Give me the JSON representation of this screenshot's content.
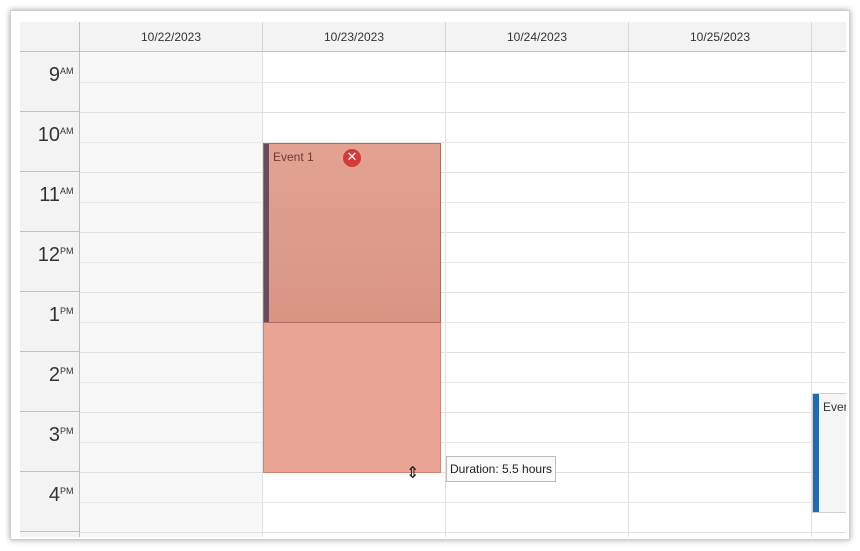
{
  "days": [
    "10/22/2023",
    "10/23/2023",
    "10/24/2023",
    "10/25/2023",
    ""
  ],
  "hours": [
    {
      "num": "9",
      "ampm": "AM"
    },
    {
      "num": "10",
      "ampm": "AM"
    },
    {
      "num": "11",
      "ampm": "AM"
    },
    {
      "num": "12",
      "ampm": "PM"
    },
    {
      "num": "1",
      "ampm": "PM"
    },
    {
      "num": "2",
      "ampm": "PM"
    },
    {
      "num": "3",
      "ampm": "PM"
    },
    {
      "num": "4",
      "ampm": "PM"
    }
  ],
  "events": [
    {
      "title": "Event 1",
      "delete_symbol": "✕",
      "color": "#e3a292",
      "bar_color": "#6a4a5c"
    },
    {
      "title": "Even",
      "color": "#f5f5f5",
      "bar_color": "#1f6bb5"
    }
  ],
  "tooltip": {
    "text": "Duration: 5.5 hours"
  },
  "cursor": {
    "symbol": "⇕"
  }
}
